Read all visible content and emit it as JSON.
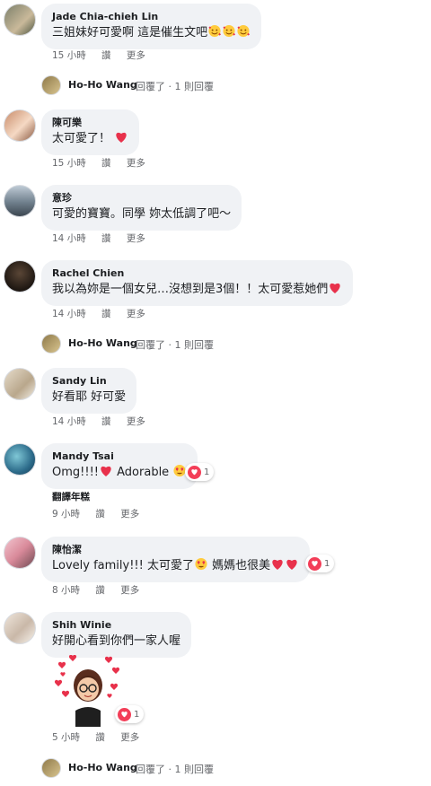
{
  "comments": [
    {
      "author": "Jade Chia-chieh Lin",
      "text": "三姐妹好可愛啊 這是催生文吧",
      "time": "15 小時",
      "like": "讚",
      "more": "更多"
    },
    {
      "author": "陳可樂",
      "text": "太可愛了！",
      "time": "15 小時",
      "like": "讚",
      "more": "更多"
    },
    {
      "author": "意珍",
      "text": "可愛的寶寶。同學 妳太低調了吧～",
      "time": "14 小時",
      "like": "讚",
      "more": "更多"
    },
    {
      "author": "Rachel Chien",
      "text": "我以為妳是一個女兒…沒想到是3個！！太可愛惹她們",
      "time": "14 小時",
      "like": "讚",
      "more": "更多"
    },
    {
      "author": "Sandy Lin",
      "text": "好看耶 好可愛",
      "time": "14 小時",
      "like": "讚",
      "more": "更多"
    },
    {
      "author": "Mandy Tsai",
      "text_a": "Omg!!!!",
      "text_b": " Adorable ",
      "reaction_count": "1",
      "translate": "翻譯年糕",
      "time": "9 小時",
      "like": "讚",
      "more": "更多"
    },
    {
      "author": "陳怡潔",
      "text_a": "Lovely family!!! 太可愛了",
      "text_b": " 媽媽也很美",
      "reaction_count": "1",
      "time": "8 小時",
      "like": "讚",
      "more": "更多"
    },
    {
      "author": "Shih Winie",
      "text": "好開心看到你們一家人喔",
      "reaction_count": "1",
      "time": "5 小時",
      "like": "讚",
      "more": "更多"
    }
  ],
  "replies": [
    {
      "name": "Ho-Ho Wang",
      "text": "回覆了 · 1 則回覆"
    },
    {
      "name": "Ho-Ho Wang",
      "text": "回覆了 · 1 則回覆"
    },
    {
      "name": "Ho-Ho Wang",
      "text": "回覆了 · 1 則回覆"
    }
  ],
  "colors": {
    "bubble": "#f0f2f5",
    "meta": "#65676b",
    "heart": "#f33e58"
  }
}
